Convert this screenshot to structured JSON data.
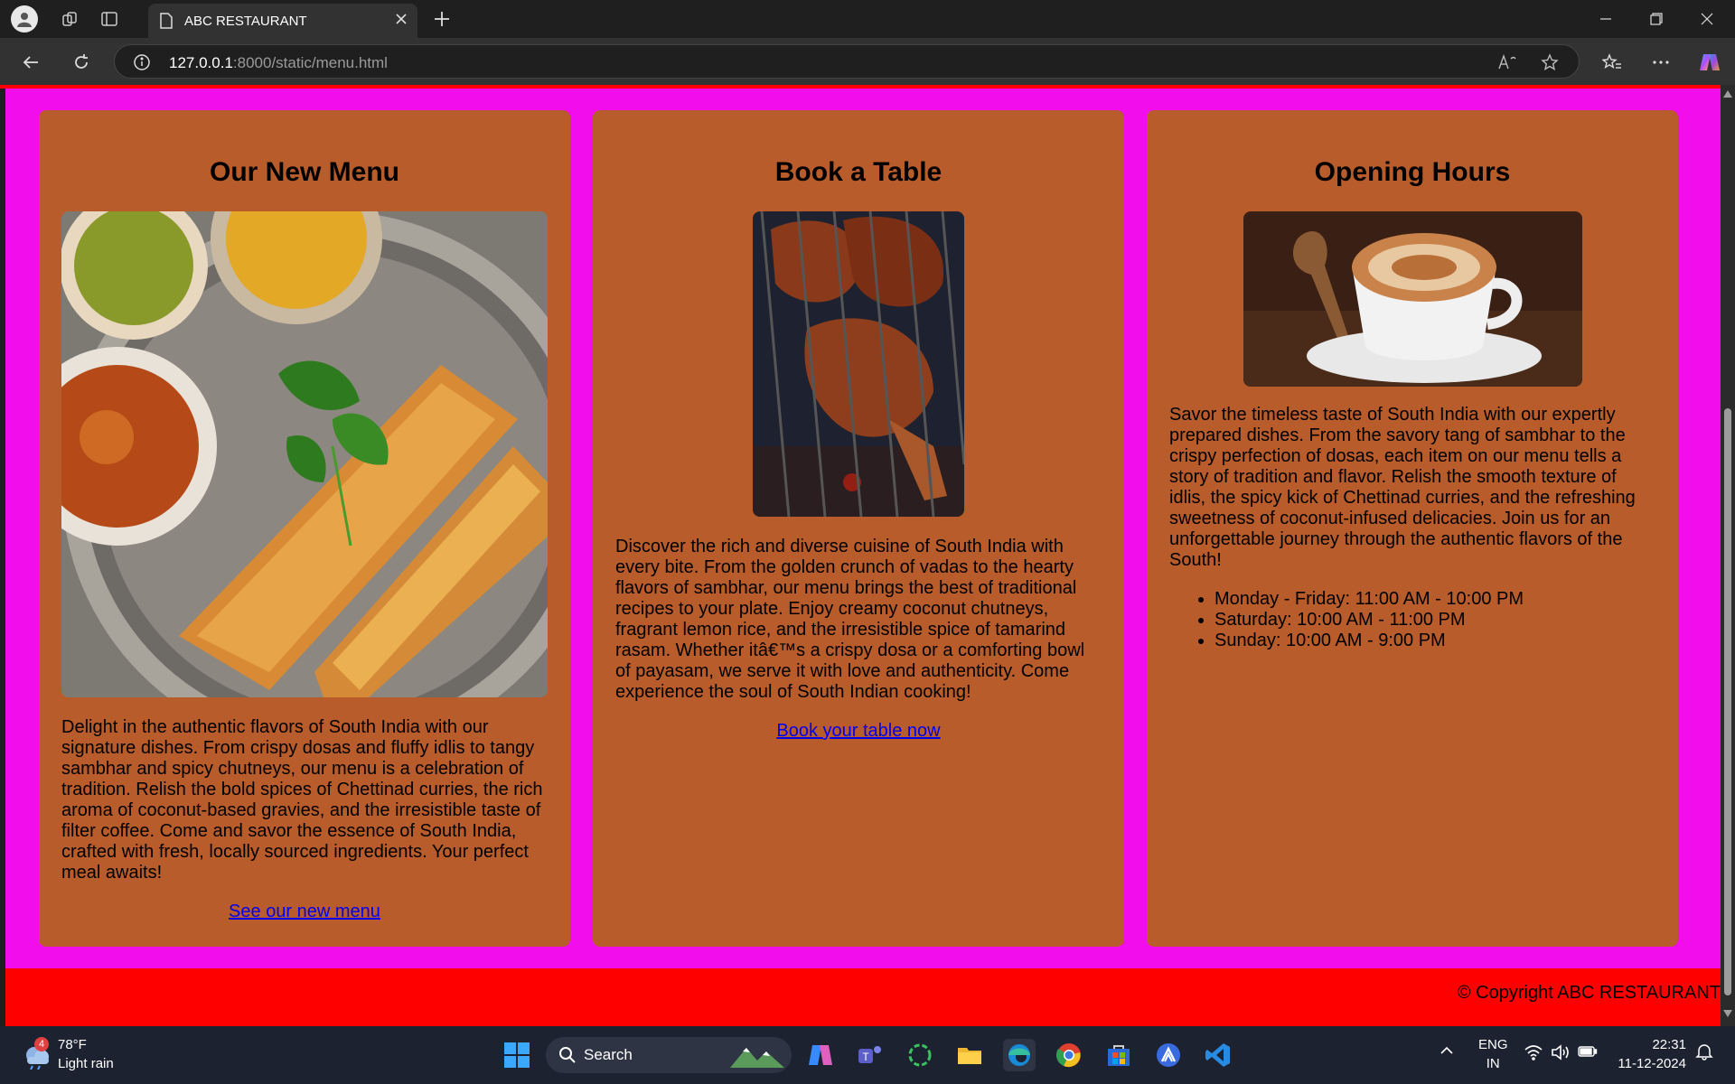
{
  "browser": {
    "tab_title": "ABC RESTAURANT",
    "url_host": "127.0.0.1",
    "url_rest": ":8000/static/menu.html"
  },
  "cards": [
    {
      "title": "Our New Menu",
      "text": "Delight in the authentic flavors of South India with our signature dishes. From crispy dosas and fluffy idlis to tangy sambhar and spicy chutneys, our menu is a celebration of tradition. Relish the bold spices of Chettinad curries, the rich aroma of coconut-based gravies, and the irresistible taste of filter coffee. Come and savor the essence of South India, crafted with fresh, locally sourced ingredients. Your perfect meal awaits!",
      "link": "See our new menu"
    },
    {
      "title": "Book a Table",
      "text": "Discover the rich and diverse cuisine of South India with every bite. From the golden crunch of vadas to the hearty flavors of sambhar, our menu brings the best of traditional recipes to your plate. Enjoy creamy coconut chutneys, fragrant lemon rice, and the irresistible spice of tamarind rasam. Whether itâ€™s a crispy dosa or a comforting bowl of payasam, we serve it with love and authenticity. Come experience the soul of South Indian cooking!",
      "link": "Book your table now"
    },
    {
      "title": "Opening Hours",
      "text": "Savor the timeless taste of South India with our expertly prepared dishes. From the savory tang of sambhar to the crispy perfection of dosas, each item on our menu tells a story of tradition and flavor. Relish the smooth texture of idlis, the spicy kick of Chettinad curries, and the refreshing sweetness of coconut-infused delicacies. Join us for an unforgettable journey through the authentic flavors of the South!",
      "hours": [
        "Monday - Friday: 11:00 AM - 10:00 PM",
        "Saturday: 10:00 AM - 11:00 PM",
        "Sunday: 10:00 AM - 9:00 PM"
      ]
    }
  ],
  "footer": "© Copyright ABC RESTAURANT",
  "taskbar": {
    "weather_temp": "78°F",
    "weather_desc": "Light rain",
    "weather_badge": "4",
    "search": "Search",
    "lang": "ENG",
    "region": "IN",
    "time": "22:31",
    "date": "11-12-2024"
  },
  "colors": {
    "page_bg": "#f20ded",
    "card_bg": "#b95c2b",
    "footer_bg": "#ff0000",
    "link": "#0000ee"
  }
}
